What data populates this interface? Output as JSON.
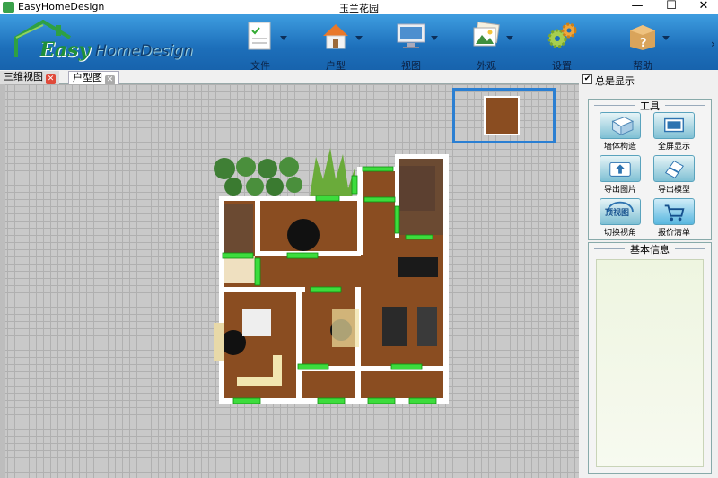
{
  "titlebar": {
    "app_title": "EasyHomeDesign",
    "document_title": "玉兰花园",
    "minimize": "—",
    "maximize": "☐",
    "close": "✕"
  },
  "logo": {
    "easy": "Easy",
    "home": "HomeDesign"
  },
  "toolbar": {
    "items": [
      {
        "label": "文件",
        "icon": "file-icon"
      },
      {
        "label": "户型",
        "icon": "house-icon"
      },
      {
        "label": "视图",
        "icon": "monitor-icon"
      },
      {
        "label": "外观",
        "icon": "picture-icon"
      },
      {
        "label": "设置",
        "icon": "gears-icon"
      },
      {
        "label": "帮助",
        "icon": "help-box-icon"
      }
    ]
  },
  "tabs": [
    {
      "label": "三维视图",
      "close": "✕"
    },
    {
      "label": "户型图",
      "close": "✕"
    }
  ],
  "sidebar": {
    "always_show": {
      "label": "总是显示",
      "checked": "✔"
    },
    "tools_title": "工具",
    "tools": [
      {
        "label": "墙体构造",
        "icon": "wall-structure-icon"
      },
      {
        "label": "全屏显示",
        "icon": "fullscreen-icon"
      },
      {
        "label": "导出图片",
        "icon": "export-image-icon"
      },
      {
        "label": "导出模型",
        "icon": "export-model-icon"
      },
      {
        "label": "切换视角",
        "icon": "switch-view-icon",
        "badge": "顶视图"
      },
      {
        "label": "报价清单",
        "icon": "cart-icon"
      }
    ],
    "info_title": "基本信息"
  },
  "colors": {
    "toolbar_top": "#3e9de0",
    "toolbar_bottom": "#1763ad",
    "floor": "#8a4d21",
    "wall": "#ffffff",
    "window": "#3ddc3d",
    "minimap_border": "#2b7fd2"
  }
}
